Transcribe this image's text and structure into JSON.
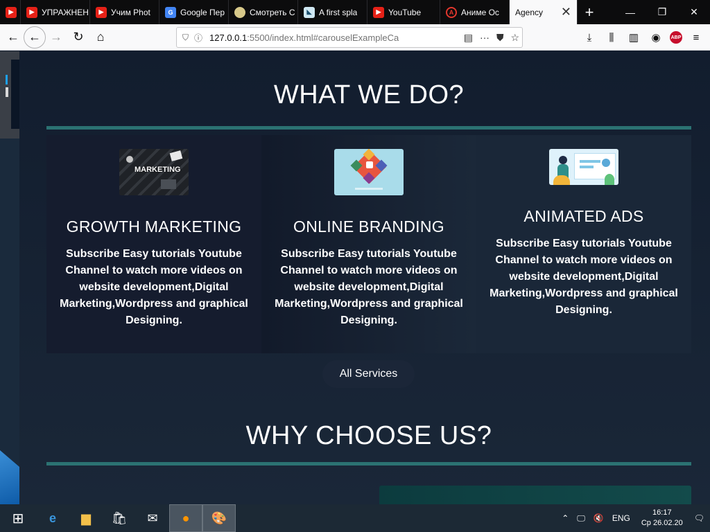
{
  "browser": {
    "tabs": [
      {
        "label": "",
        "icon": "youtube-icon",
        "width": 30
      },
      {
        "label": "УПРАЖНЕН",
        "icon": "youtube-icon",
        "width": 100
      },
      {
        "label": "Учим Phot",
        "icon": "youtube-icon",
        "width": 100
      },
      {
        "label": "Google Пер",
        "icon": "google-translate-icon",
        "width": 100
      },
      {
        "label": "Смотреть С",
        "icon": "anime-icon",
        "width": 100
      },
      {
        "label": "A first spla",
        "icon": "bookmark-icon",
        "width": 100
      },
      {
        "label": "YouTube",
        "icon": "youtube-icon",
        "width": 105
      },
      {
        "label": "Аниме Ос",
        "icon": "anime-site-icon",
        "width": 100
      }
    ],
    "active_tab": "Agency",
    "url_main": "127.0.0.1",
    "url_rest": ":5500/index.html#carouselExampleCa"
  },
  "page": {
    "section1_title": "WHAT WE DO?",
    "services": [
      {
        "title": "GROWTH MARKETING",
        "desc": "Subscribe Easy tutorials Youtube Channel to watch more videos on website development,Digital Marketing,Wordpress and graphical Designing."
      },
      {
        "title": "ONLINE BRANDING",
        "desc": "Subscribe Easy tutorials Youtube Channel to watch more videos on website development,Digital Marketing,Wordpress and graphical Designing."
      },
      {
        "title": "ANIMATED ADS",
        "desc": "Subscribe Easy tutorials Youtube Channel to watch more videos on website development,Digital Marketing,Wordpress and graphical Designing."
      }
    ],
    "thumb1_text": "MARKETING",
    "all_services_label": "All Services",
    "section2_title": "WHY CHOOSE US?"
  },
  "taskbar": {
    "lang": "ENG",
    "time": "16:17",
    "date": "Ср 26.02.20"
  },
  "colors": {
    "accent_rule": "#2b7272",
    "page_bg": "#121d2e"
  }
}
